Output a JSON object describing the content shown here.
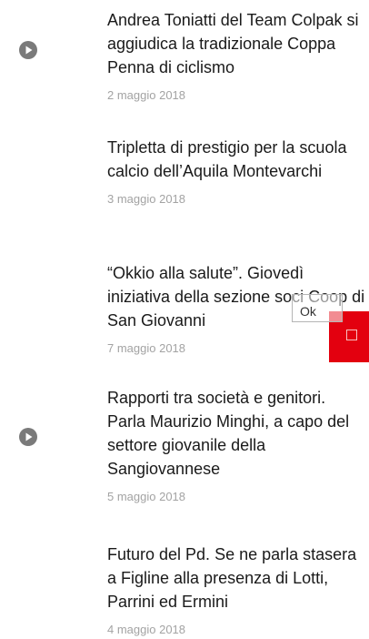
{
  "articles": [
    {
      "title": "Andrea Toniatti del Team Colpak si aggiudica la tradizionale Coppa Penna di ciclismo",
      "date": "2 maggio 2018",
      "has_video": true
    },
    {
      "title": "Tripletta di prestigio per la scuola calcio dell’Aquila Montevarchi",
      "date": "3 maggio 2018",
      "has_video": false
    },
    {
      "title": "“Okkio alla salute”. Giovedì iniziativa della sezione soci Coop di San Giovanni",
      "date": "7 maggio 2018",
      "has_video": false
    },
    {
      "title": "Rapporti tra società e genitori. Parla Maurizio Minghi, a capo del settore giovanile della Sangiovannese",
      "date": "5 maggio 2018",
      "has_video": true
    },
    {
      "title": "Futuro del Pd. Se ne parla stasera a Figline alla presenza di Lotti, Parrini ed Ermini",
      "date": "4 maggio 2018",
      "has_video": false
    }
  ],
  "overlay": {
    "ok_label": "Ok"
  },
  "colors": {
    "title": "#1a1a1a",
    "date": "#a3a3a3",
    "play_icon": "#7a7a7a",
    "red_block": "#e3000f"
  },
  "icons": {
    "video": "play-circle-icon"
  }
}
